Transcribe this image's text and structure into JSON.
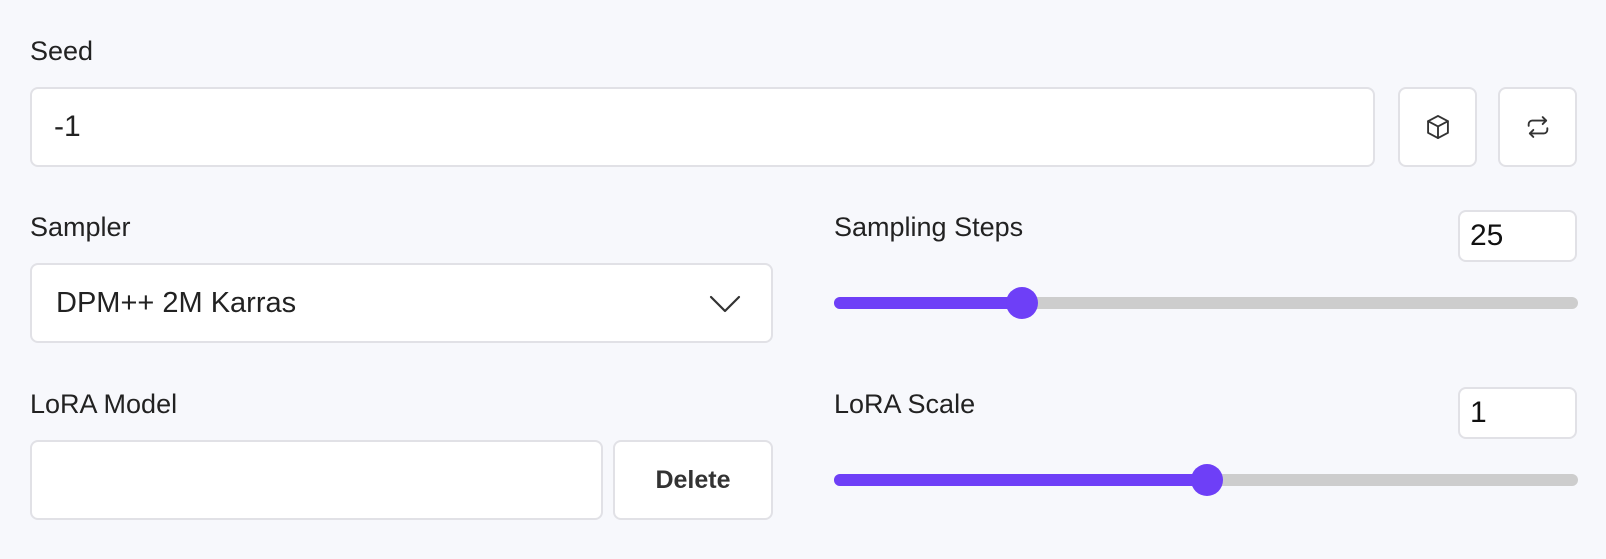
{
  "seed": {
    "label": "Seed",
    "value": "-1",
    "random_button_icon": "cube-icon",
    "reuse_button_icon": "recycle-icon"
  },
  "sampler": {
    "label": "Sampler",
    "selected": "DPM++ 2M Karras",
    "dropdown_icon": "chevron-down-icon"
  },
  "sampling_steps": {
    "label": "Sampling Steps",
    "value": "25",
    "slider_fraction": 0.253
  },
  "lora_model": {
    "label": "LoRA Model",
    "value": "",
    "delete_label": "Delete"
  },
  "lora_scale": {
    "label": "LoRA Scale",
    "value": "1",
    "slider_fraction": 0.502
  },
  "colors": {
    "accent": "#6e3ff7",
    "track": "#cdcdcd",
    "background": "#f7f8fc",
    "border": "#e1e1e6"
  }
}
